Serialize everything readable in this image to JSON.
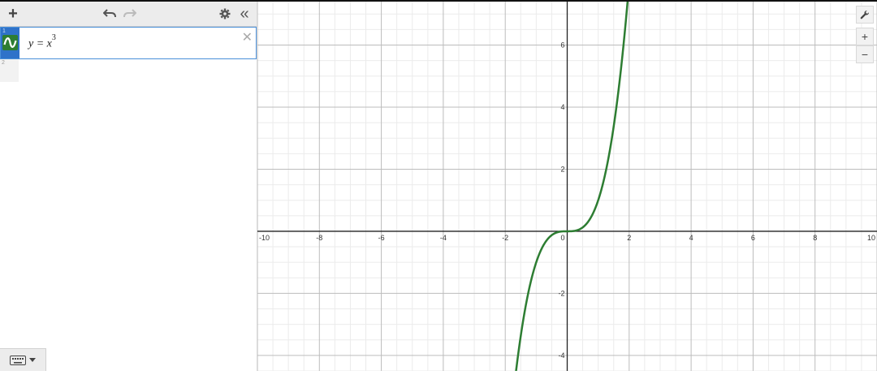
{
  "toolbar": {
    "add_icon": "plus-icon",
    "undo_icon": "undo-icon",
    "redo_icon": "redo-icon",
    "settings_icon": "gear-icon",
    "collapse_icon": "double-chevron-left-icon",
    "add_label": "+",
    "collapse_label": "«"
  },
  "expressions": [
    {
      "index": "1",
      "lhs": "y = x",
      "exponent": "3",
      "color": "#2d7d32",
      "close_label": "✕"
    },
    {
      "index": "2"
    }
  ],
  "graph_controls": {
    "settings_icon": "wrench-icon",
    "zoom_in": "+",
    "zoom_out": "−"
  },
  "chart_data": {
    "type": "line",
    "equation": "y = x^3",
    "series": [
      {
        "color": "#2d7d32",
        "function": "x^3"
      }
    ],
    "xlim": [
      -10,
      10
    ],
    "ylim": [
      -4.5,
      7.4
    ],
    "x_ticks": [
      "-10",
      "-8",
      "-6",
      "-4",
      "-2",
      "2",
      "4",
      "6",
      "8",
      "10"
    ],
    "y_ticks": [
      "6",
      "4",
      "2",
      "-2",
      "-4"
    ],
    "origin_label": "0",
    "grid": true
  }
}
